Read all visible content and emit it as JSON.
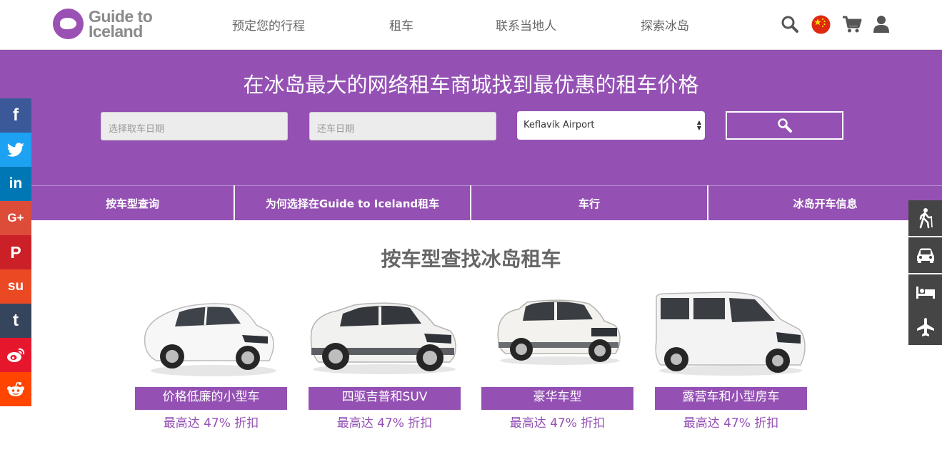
{
  "header": {
    "logo_line1": "Guide to",
    "logo_line2": "Iceland",
    "nav": [
      "预定您的行程",
      "租车",
      "联系当地人",
      "探索冰岛"
    ]
  },
  "hero": {
    "title": "在冰岛最大的网络租车商城找到最优惠的租车价格",
    "pickup_placeholder": "选择取车日期",
    "return_placeholder": "还车日期",
    "location_value": "Keflavík Airport"
  },
  "tabs": [
    "按车型查询",
    "为何选择在Guide to Iceland租车",
    "车行",
    "冰岛开车信息"
  ],
  "section_title": "按车型查找冰岛租车",
  "cars": [
    {
      "label": "价格低廉的小型车",
      "discount": "最高达 47% 折扣"
    },
    {
      "label": "四驱吉普和SUV",
      "discount": "最高达 47% 折扣"
    },
    {
      "label": "豪华车型",
      "discount": "最高达 47% 折扣"
    },
    {
      "label": "露营车和小型房车",
      "discount": "最高达 47% 折扣"
    }
  ],
  "social": [
    {
      "icon": "facebook-icon",
      "glyph": "f",
      "color": "#3b5998"
    },
    {
      "icon": "twitter-icon",
      "glyph": "",
      "color": "#1da1f2"
    },
    {
      "icon": "linkedin-icon",
      "glyph": "in",
      "color": "#0077b5"
    },
    {
      "icon": "google-plus-icon",
      "glyph": "G+",
      "color": "#dd4b39"
    },
    {
      "icon": "pinterest-icon",
      "glyph": "P",
      "color": "#cb2027"
    },
    {
      "icon": "stumbleupon-icon",
      "glyph": "su",
      "color": "#eb4924"
    },
    {
      "icon": "tumblr-icon",
      "glyph": "t",
      "color": "#35465c"
    },
    {
      "icon": "weibo-icon",
      "glyph": "",
      "color": "#e6162d"
    },
    {
      "icon": "reddit-icon",
      "glyph": "",
      "color": "#ff4500"
    }
  ],
  "right_sidebar": [
    "hiking-icon",
    "car-icon",
    "bed-icon",
    "airplane-icon"
  ],
  "colors": {
    "brand": "#9451b3",
    "sidebar": "#454545"
  }
}
